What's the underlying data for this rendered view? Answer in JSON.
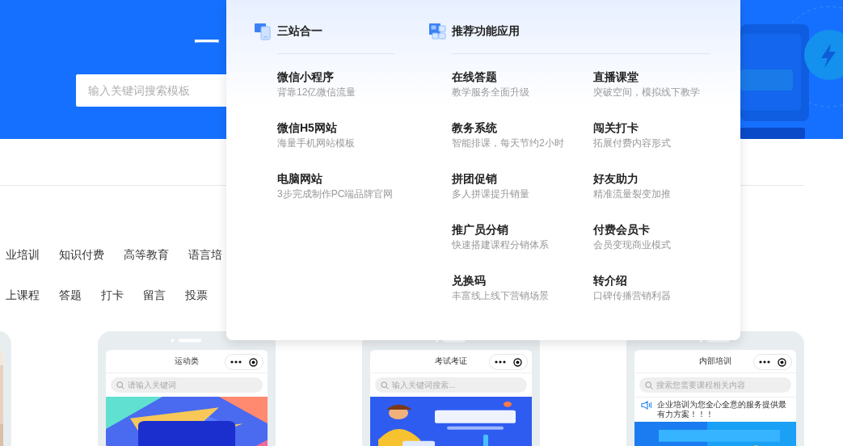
{
  "hero": {
    "title": "一",
    "search_placeholder": "输入关键词搜索模板"
  },
  "filter_rows": [
    [
      "业培训",
      "知识付费",
      "高等教育",
      "语言培"
    ],
    [
      "上课程",
      "答题",
      "打卡",
      "留言",
      "投票"
    ]
  ],
  "templates": [
    {
      "kind": "cut"
    },
    {
      "kind": "phone",
      "title": "运动类",
      "search_placeholder": "请输入关键词"
    },
    {
      "kind": "phone",
      "title": "考试考证",
      "search_placeholder": "输入关键词搜索..."
    },
    {
      "kind": "phone",
      "title": "内部培训",
      "search_placeholder": "搜索您需要课程相关内容",
      "notice": "企业培训为您全心全意的服务提供最有力方案！！！"
    }
  ],
  "dropdown": {
    "sections": [
      {
        "heading": "三站合一",
        "kind": "sites",
        "items": [
          {
            "title": "微信小程序",
            "desc": "背靠12亿微信流量"
          },
          {
            "title": "微信H5网站",
            "desc": "海量手机网站模板"
          },
          {
            "title": "电脑网站",
            "desc": "3步完成制作PC端品牌官网"
          }
        ]
      },
      {
        "heading": "推荐功能应用",
        "kind": "apps",
        "items": [
          {
            "title": "在线答题",
            "desc": "教学服务全面升级"
          },
          {
            "title": "直播课堂",
            "desc": "突破空间，模拟线下教学"
          },
          {
            "title": "教务系统",
            "desc": "智能排课，每天节约2小时"
          },
          {
            "title": "闯关打卡",
            "desc": "拓展付费内容形式"
          },
          {
            "title": "拼团促销",
            "desc": "多人拼课提升销量"
          },
          {
            "title": "好友助力",
            "desc": "精准流量裂变加推"
          },
          {
            "title": "推广员分销",
            "desc": "快速搭建课程分销体系"
          },
          {
            "title": "付费会员卡",
            "desc": "会员变现商业模式"
          },
          {
            "title": "兑换码",
            "desc": "丰富线上线下营销场景"
          },
          {
            "title": "转介绍",
            "desc": "口碑传播营销利器"
          }
        ]
      }
    ]
  }
}
